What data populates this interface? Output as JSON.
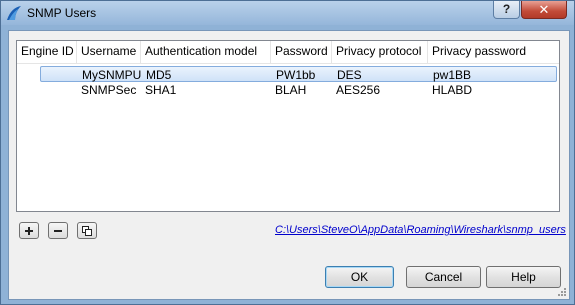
{
  "window": {
    "title": "SNMP Users",
    "help_glyph": "?",
    "close_glyph": "✕",
    "app_icon": "wireshark-fin-icon"
  },
  "table": {
    "columns": [
      "Engine ID",
      "Username",
      "Authentication model",
      "Password",
      "Privacy protocol",
      "Privacy password"
    ],
    "rows": [
      {
        "engine_id": "",
        "username": "MySNMPU",
        "auth_model": "MD5",
        "password": "PW1bb",
        "privacy_protocol": "DES",
        "privacy_password": "pw1BB",
        "selected": true
      },
      {
        "engine_id": "",
        "username": "SNMPSec",
        "auth_model": "SHA1",
        "password": "BLAH",
        "privacy_protocol": "AES256",
        "privacy_password": "HLABD",
        "selected": false
      }
    ]
  },
  "toolbar": {
    "add_icon": "plus-icon",
    "remove_icon": "minus-icon",
    "copy_icon": "copy-icon"
  },
  "file_path": "C:\\Users\\SteveO\\AppData\\Roaming\\Wireshark\\snmp_users",
  "buttons": {
    "ok": "OK",
    "cancel": "Cancel",
    "help": "Help"
  }
}
